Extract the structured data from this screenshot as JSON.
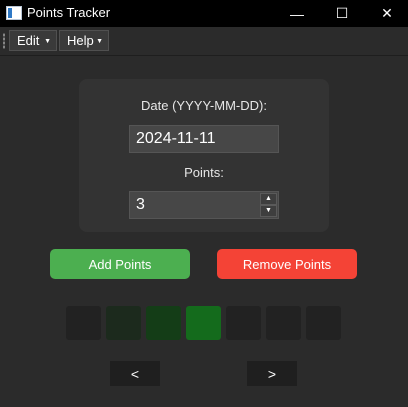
{
  "window": {
    "title": "Points Tracker",
    "minimize_glyph": "—",
    "maximize_glyph": "☐",
    "close_glyph": "✕"
  },
  "menu": {
    "edit": "Edit",
    "help": "Help",
    "arrow_glyph": "▼"
  },
  "form": {
    "date_label": "Date (YYYY-MM-DD):",
    "date_value": "2024-11-11",
    "points_label": "Points:",
    "points_value": "3",
    "spin_up_glyph": "▲",
    "spin_down_glyph": "▼"
  },
  "actions": {
    "add": "Add Points",
    "remove": "Remove Points"
  },
  "calendar": {
    "day_colors": [
      "#222222",
      "#1c2a1d",
      "#143d17",
      "#146b1c",
      "#222222",
      "#222222",
      "#222222"
    ]
  },
  "nav": {
    "prev": "<",
    "next": ">"
  },
  "colors": {
    "add_button": "#4caf50",
    "remove_button": "#f44336",
    "background": "#2b2b2b"
  }
}
